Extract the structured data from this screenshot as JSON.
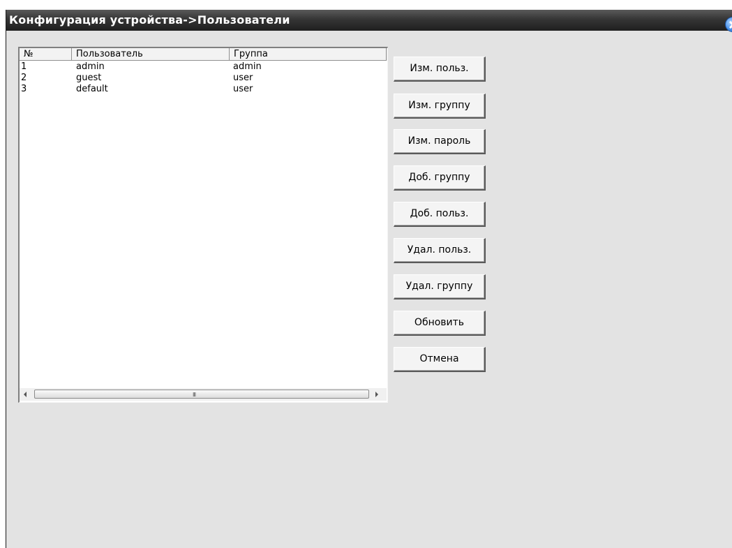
{
  "window": {
    "title": "Конфигурация устройства->Пользователи"
  },
  "table": {
    "columns": [
      "№",
      "Пользователь",
      "Группа"
    ],
    "rows": [
      {
        "no": "1",
        "user": "admin",
        "group": "admin"
      },
      {
        "no": "2",
        "user": "guest",
        "group": "user"
      },
      {
        "no": "3",
        "user": "default",
        "group": "user"
      }
    ],
    "scroll_grip": "III"
  },
  "buttons": {
    "edit_user": "Изм. польз.",
    "edit_group": "Изм. группу",
    "edit_password": "Изм. пароль",
    "add_group": "Доб. группу",
    "add_user": "Доб. польз.",
    "delete_user": "Удал. польз.",
    "delete_group": "Удал. группу",
    "refresh": "Обновить",
    "cancel": "Отмена"
  },
  "icons": {
    "close": "close-icon",
    "scroll_left": "arrow-left-icon",
    "scroll_right": "arrow-right-icon"
  }
}
